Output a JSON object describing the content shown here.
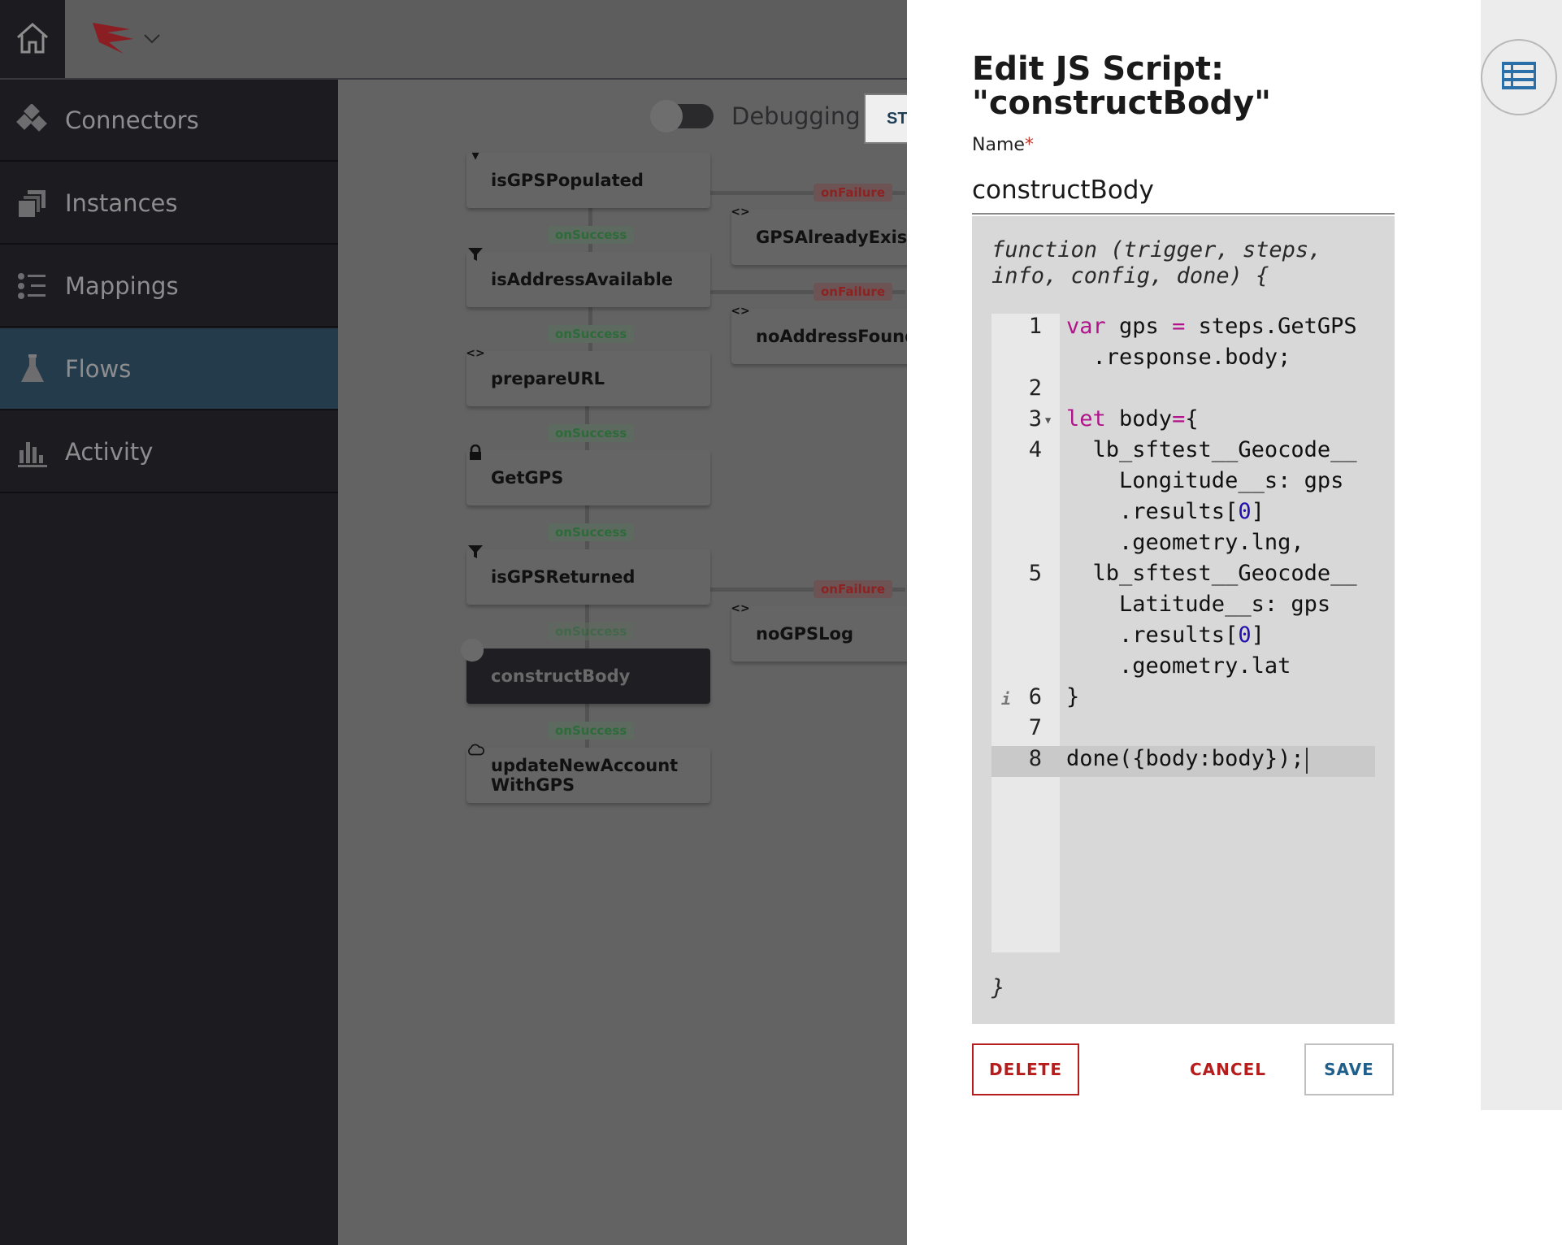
{
  "sidebar": {
    "items": [
      {
        "label": "Connectors",
        "icon": "connectors-icon"
      },
      {
        "label": "Instances",
        "icon": "instances-icon"
      },
      {
        "label": "Mappings",
        "icon": "mappings-icon"
      },
      {
        "label": "Flows",
        "icon": "flask-icon",
        "active": true
      },
      {
        "label": "Activity",
        "icon": "bar-chart-icon"
      }
    ]
  },
  "toolbar": {
    "debug_label": "Debugging",
    "start_label": "ST"
  },
  "flow": {
    "nodes": [
      {
        "label": "isGPSPopulated",
        "icon": "filter-icon"
      },
      {
        "label": "isAddressAvailable",
        "icon": "filter-icon"
      },
      {
        "label": "prepareURL",
        "icon": "code-icon"
      },
      {
        "label": "GetGPS",
        "icon": "lock-icon"
      },
      {
        "label": "isGPSReturned",
        "icon": "filter-icon"
      },
      {
        "label": "constructBody",
        "icon": "script-icon",
        "selected": true
      },
      {
        "label": "updateNewAccountWithGPS",
        "icon": "cloud-icon"
      },
      {
        "label": "GPSAlreadyExists",
        "icon": "code-icon"
      },
      {
        "label": "noAddressFound",
        "icon": "code-icon"
      },
      {
        "label": "noGPSLog",
        "icon": "code-icon"
      }
    ],
    "badges": {
      "success": "onSuccess",
      "failure": "onFailure"
    }
  },
  "modal": {
    "title": "Edit JS Script: \"constructBody\"",
    "name_label": "Name",
    "required_mark": "*",
    "name_value": "constructBody",
    "function_header": "function (trigger, steps, info, config, done) {",
    "function_footer": "}",
    "code_lines": [
      {
        "num": "1",
        "parts": [
          {
            "t": "var",
            "c": "kw"
          },
          {
            "t": " gps "
          },
          {
            "t": "=",
            "c": "kw"
          },
          {
            "t": " steps.GetGPS"
          }
        ]
      },
      {
        "num": "",
        "parts": [
          {
            "t": "  .response.body;"
          }
        ]
      },
      {
        "num": "2",
        "parts": []
      },
      {
        "num": "3",
        "parts": [
          {
            "t": "let",
            "c": "kw"
          },
          {
            "t": " body"
          },
          {
            "t": "=",
            "c": "kw"
          },
          {
            "t": "{"
          }
        ]
      },
      {
        "num": "4",
        "parts": [
          {
            "t": "  lb_sftest__Geocode__"
          }
        ]
      },
      {
        "num": "",
        "parts": [
          {
            "t": "    Longitude__s: gps"
          }
        ]
      },
      {
        "num": "",
        "parts": [
          {
            "t": "    .results["
          },
          {
            "t": "0",
            "c": "num"
          },
          {
            "t": "]"
          }
        ]
      },
      {
        "num": "",
        "parts": [
          {
            "t": "    .geometry.lng,"
          }
        ]
      },
      {
        "num": "5",
        "parts": [
          {
            "t": "  lb_sftest__Geocode__"
          }
        ]
      },
      {
        "num": "",
        "parts": [
          {
            "t": "    Latitude__s: gps"
          }
        ]
      },
      {
        "num": "",
        "parts": [
          {
            "t": "    .results["
          },
          {
            "t": "0",
            "c": "num"
          },
          {
            "t": "]"
          }
        ]
      },
      {
        "num": "",
        "parts": [
          {
            "t": "    .geometry.lat"
          }
        ]
      },
      {
        "num": "6",
        "parts": [
          {
            "t": "}"
          }
        ]
      },
      {
        "num": "7",
        "parts": []
      },
      {
        "num": "8",
        "parts": [
          {
            "t": "done({body:body});"
          }
        ]
      }
    ],
    "buttons": {
      "delete": "DELETE",
      "cancel": "CANCEL",
      "save": "SAVE"
    }
  },
  "colors": {
    "accent": "#1f5f8b",
    "danger": "#b71c1c",
    "keyword": "#b0138a",
    "number": "#2211aa"
  }
}
